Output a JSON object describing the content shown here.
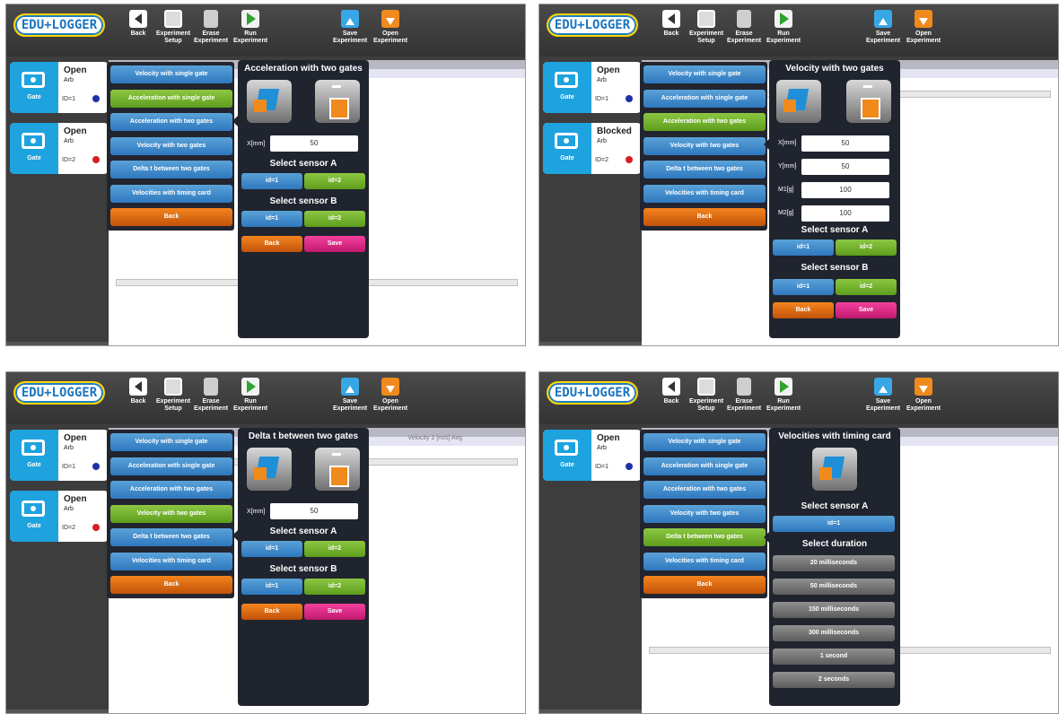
{
  "toolbar": {
    "logo": "EDU+LOGGER",
    "back": "Back",
    "setup": "Experiment Setup",
    "erase": "Erase Experiment",
    "run": "Run Experiment",
    "save": "Save Experiment",
    "open": "Open Experiment"
  },
  "sensors": [
    {
      "status": "Open",
      "arb": "Arb",
      "id": "ID=1",
      "gate": "Gate",
      "dot": "#1f2fa8"
    },
    {
      "status": "Open",
      "arb": "Arb",
      "id": "ID=2",
      "gate": "Gate",
      "dot": "#d81f1f"
    },
    {
      "status": "Blocked",
      "arb": "Arb",
      "id": "ID=2",
      "gate": "Gate"
    }
  ],
  "menu": [
    "Velocity with single gate",
    "Acceleration with single gate",
    "Acceleration with two gates",
    "Velocity with two gates",
    "Delta t between two gates",
    "Velocities with timing card",
    "Back"
  ],
  "canvas_header": "Velocity 2 [m/s] Avg",
  "dlg_acc": {
    "title": "Acceleration with two gates",
    "x_label": "X[mm]",
    "x_val": "50",
    "sel_a": "Select sensor A",
    "sel_b": "Select sensor B",
    "id1": "id=1",
    "id2": "id=2",
    "back": "Back",
    "save": "Save"
  },
  "dlg_vel": {
    "title": "Velocity with two gates",
    "x_label": "X[mm]",
    "x_val": "50",
    "y_label": "Y[mm]",
    "y_val": "50",
    "m1_label": "M1[g]",
    "m1_val": "100",
    "m2_label": "M2[g]",
    "m2_val": "100"
  },
  "dlg_delta": {
    "title": "Delta t between two gates"
  },
  "dlg_card": {
    "title": "Velocities with timing card",
    "sel_a": "Select sensor A",
    "id1": "id=1",
    "sel_dur": "Select duration",
    "durations": [
      "20 milliseconds",
      "50 milliseconds",
      "150 milliseconds",
      "300 milliseconds",
      "1 second",
      "2 seconds"
    ]
  }
}
